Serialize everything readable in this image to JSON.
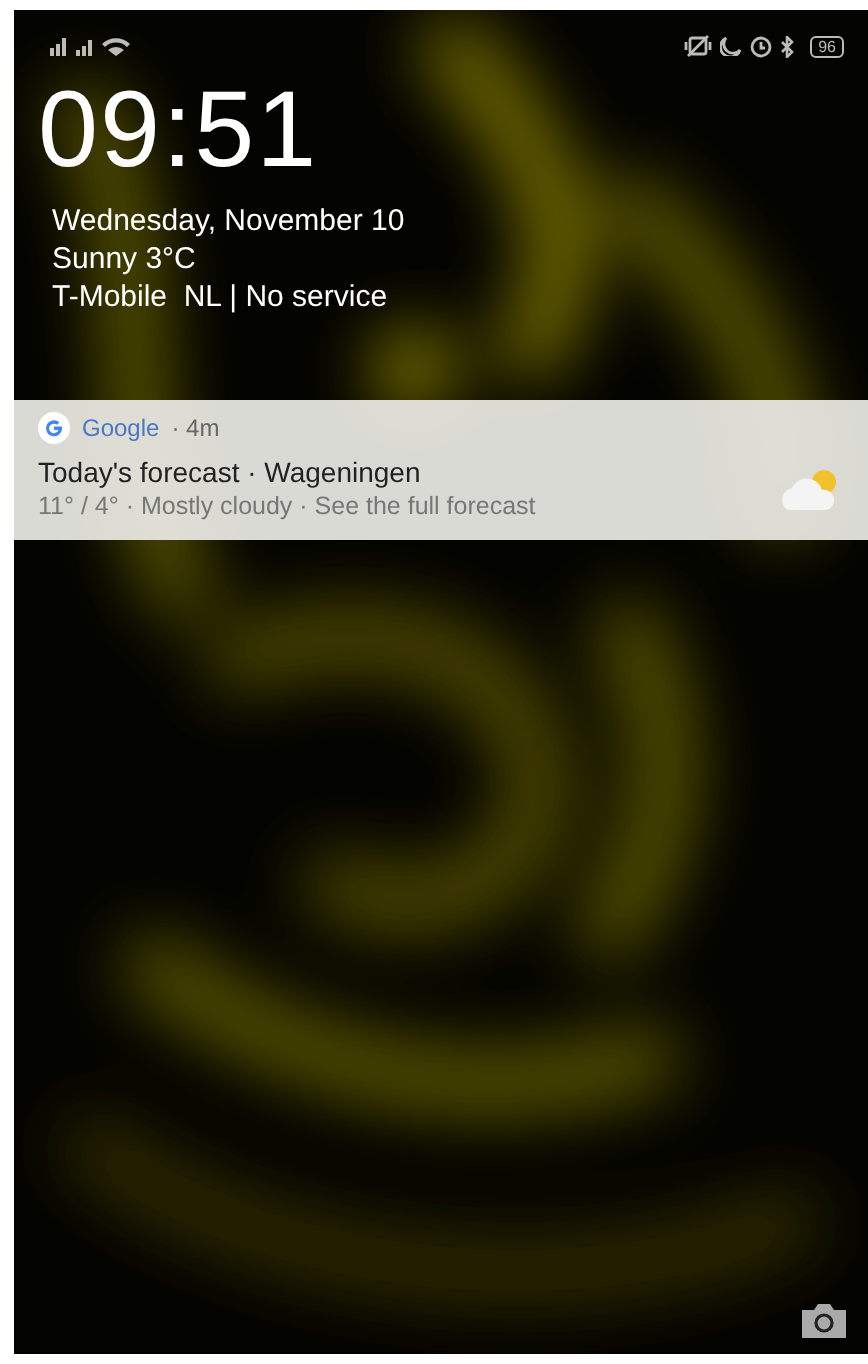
{
  "status_bar": {
    "battery": "96"
  },
  "lock_screen": {
    "clock": "09:51",
    "date": "Wednesday, November 10",
    "weather": "Sunny 3°C",
    "carrier": "T-Mobile  NL | No service"
  },
  "notification": {
    "app": "Google",
    "time": "· 4m",
    "title": "Today's forecast · Wageningen",
    "text": "11° / 4° · Mostly cloudy · See the full forecast"
  }
}
